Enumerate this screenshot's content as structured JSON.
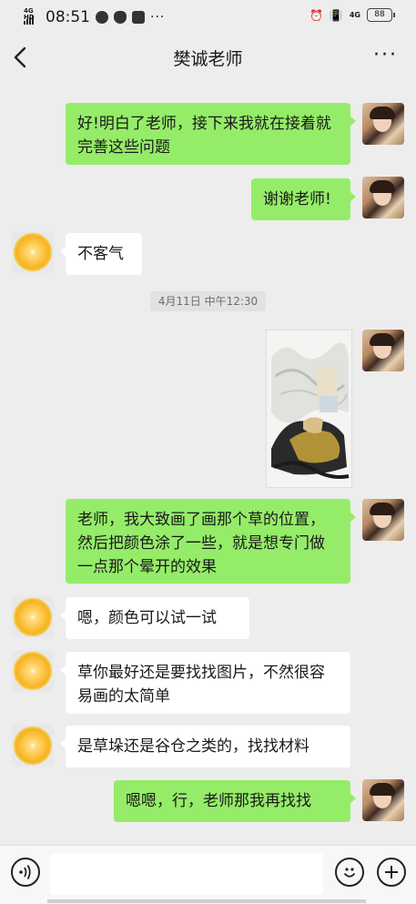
{
  "status_bar": {
    "network": "4G HD",
    "time": "08:51",
    "dots": "···",
    "network_right": "4G",
    "battery": "88"
  },
  "nav": {
    "title": "樊诚老师",
    "more": "···"
  },
  "messages": [
    {
      "from": "me",
      "text": "好!明白了老师，接下来我就在接着就完善这些问题"
    },
    {
      "from": "me",
      "text": "谢谢老师!"
    },
    {
      "from": "other",
      "text": "不客气"
    },
    {
      "from": "me",
      "type": "image",
      "alt": ""
    },
    {
      "from": "me",
      "text": "老师，我大致画了画那个草的位置，然后把颜色涂了一些，就是想专门做一点那个晕开的效果"
    },
    {
      "from": "other",
      "text": "嗯，颜色可以试一试"
    },
    {
      "from": "other",
      "text": "草你最好还是要找找图片，不然很容易画的太简单"
    },
    {
      "from": "other",
      "text": "是草垛还是谷仓之类的，找找材料"
    },
    {
      "from": "me",
      "text": "嗯嗯，行，老师那我再找找"
    }
  ],
  "timestamp": "4月11日 中午12:30",
  "input": {
    "value": "",
    "placeholder": ""
  },
  "colors": {
    "background": "#ededed",
    "my_bubble": "#95ec69",
    "other_bubble": "#ffffff"
  }
}
